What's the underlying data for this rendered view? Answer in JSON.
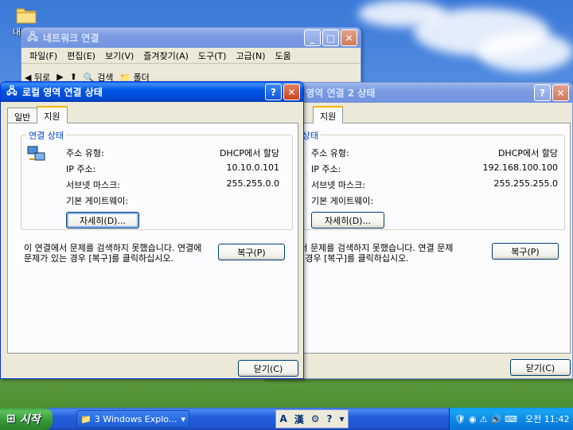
{
  "desktop": {
    "icon_label": "내"
  },
  "network_window": {
    "title": "네트워크 연결",
    "menus": [
      "파일(F)",
      "편집(E)",
      "보기(V)",
      "즐겨찾기(A)",
      "도구(T)",
      "고급(N)",
      "도움"
    ],
    "toolbar": {
      "back": "뒤로",
      "search": "검색",
      "folders": "폴더"
    }
  },
  "dialog_front": {
    "title": "로컬 영역 연결 상태",
    "tabs": [
      "일반",
      "지원"
    ],
    "group_label": "연결 상태",
    "rows": [
      {
        "label": "주소 유형:",
        "value": "DHCP에서 할당"
      },
      {
        "label": "IP 주소:",
        "value": "10.10.0.101"
      },
      {
        "label": "서브넷 마스크:",
        "value": "255.255.0.0"
      },
      {
        "label": "기본 게이트웨이:",
        "value": ""
      }
    ],
    "details_button": "자세히(D)...",
    "message": "이 연결에서 문제를 검색하지 못했습니다. 연결에 문제가 있는 경우 [복구]를 클릭하십시오.",
    "repair_button": "복구(P)",
    "close_button": "닫기(C)"
  },
  "dialog_back": {
    "title": "로컬 영역 연결 2 상태",
    "tab": "지원",
    "group_label": "연결 상태",
    "rows": [
      {
        "label": "주소 유형:",
        "value": "DHCP에서 할당"
      },
      {
        "label": "IP 주소:",
        "value": "192.168.100.100"
      },
      {
        "label": "서브넷 마스크:",
        "value": "255.255.255.0"
      },
      {
        "label": "기본 게이트웨이:",
        "value": ""
      }
    ],
    "details_button": "자세히(D)...",
    "message": "연결에서 문제를 검색하지 못했습니다. 연결 문제가 있는 경우 [복구]를 클릭하십시오.",
    "repair_button": "복구(P)",
    "close_button": "닫기(C)"
  },
  "taskbar": {
    "start_label": "시작",
    "task_button": "3 Windows Explo...",
    "ime_a": "A",
    "ime_han": "漢",
    "clock": "오전 11:42"
  }
}
